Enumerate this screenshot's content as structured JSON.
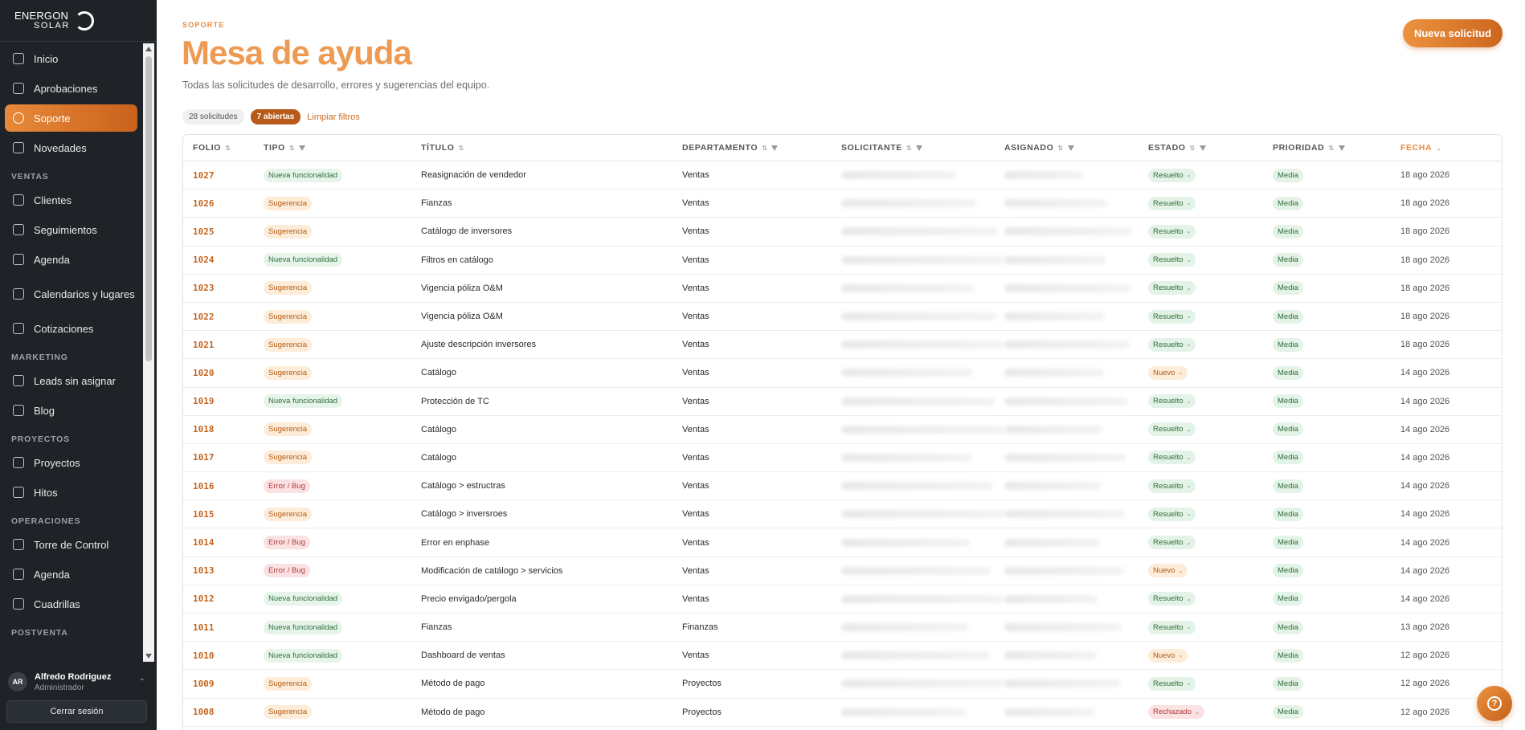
{
  "brand": {
    "name": "ENERGON",
    "sub": "SOLAR"
  },
  "nav": {
    "items_top": [
      {
        "label": "Inicio",
        "name": "sidebar-item-inicio"
      },
      {
        "label": "Aprobaciones",
        "name": "sidebar-item-aprobaciones"
      },
      {
        "label": "Soporte",
        "name": "sidebar-item-soporte",
        "active": true
      }
    ],
    "sections": [
      {
        "title": "VENTAS",
        "items": [
          {
            "label": "Novedades",
            "name": "sidebar-item-novedades",
            "pre": true
          },
          {
            "label": "Clientes",
            "name": "sidebar-item-clientes"
          },
          {
            "label": "Seguimientos",
            "name": "sidebar-item-seguimientos"
          },
          {
            "label": "Agenda",
            "name": "sidebar-item-agenda"
          },
          {
            "label": "Calendarios y lugares",
            "name": "sidebar-item-calendarios",
            "two": true
          },
          {
            "label": "Cotizaciones",
            "name": "sidebar-item-cotizaciones"
          }
        ]
      },
      {
        "title": "MARKETING",
        "items": [
          {
            "label": "Leads sin asignar",
            "name": "sidebar-item-leads"
          },
          {
            "label": "Blog",
            "name": "sidebar-item-blog"
          }
        ]
      },
      {
        "title": "PROYECTOS",
        "items": [
          {
            "label": "Proyectos",
            "name": "sidebar-item-proyectos"
          },
          {
            "label": "Hitos",
            "name": "sidebar-item-hitos"
          }
        ]
      },
      {
        "title": "OPERACIONES",
        "items": [
          {
            "label": "Torre de Control",
            "name": "sidebar-item-torre"
          },
          {
            "label": "Agenda",
            "name": "sidebar-item-agenda-ops"
          },
          {
            "label": "Cuadrillas",
            "name": "sidebar-item-cuadrillas"
          }
        ]
      },
      {
        "title": "POSTVENTA",
        "items": []
      }
    ]
  },
  "user": {
    "initials": "AR",
    "name": "Alfredo Rodriguez",
    "role": "Administrador"
  },
  "logout_label": "Cerrar sesión",
  "header": {
    "eyebrow": "SOPORTE",
    "title": "Mesa de ayuda",
    "description": "Todas las solicitudes de desarrollo, errores y sugerencias del equipo.",
    "new_button": "Nueva solicitud"
  },
  "filters": {
    "count": "28 solicitudes",
    "open": "7 abiertas",
    "clear": "Limpiar filtros"
  },
  "table": {
    "columns": [
      {
        "label": "FOLIO",
        "sort": true,
        "filter": false
      },
      {
        "label": "TIPO",
        "sort": true,
        "filter": true
      },
      {
        "label": "TÍTULO",
        "sort": true,
        "filter": false
      },
      {
        "label": "DEPARTAMENTO",
        "sort": true,
        "filter": true
      },
      {
        "label": "SOLICITANTE",
        "sort": true,
        "filter": true
      },
      {
        "label": "ASIGNADO",
        "sort": true,
        "filter": true
      },
      {
        "label": "ESTADO",
        "sort": true,
        "filter": true
      },
      {
        "label": "PRIORIDAD",
        "sort": true,
        "filter": true
      },
      {
        "label": "FECHA",
        "sort": true,
        "filter": false,
        "active": true
      }
    ],
    "rows": [
      {
        "folio": "1027",
        "tipo": "Nueva funcionalidad",
        "titulo": "Reasignación de vendedor",
        "depto": "Ventas",
        "estado": "Resuelto",
        "prioridad": "Media",
        "fecha": "18 ago 2026"
      },
      {
        "folio": "1026",
        "tipo": "Sugerencia",
        "titulo": "Fianzas",
        "depto": "Ventas",
        "estado": "Resuelto",
        "prioridad": "Media",
        "fecha": "18 ago 2026"
      },
      {
        "folio": "1025",
        "tipo": "Sugerencia",
        "titulo": "Catálogo de inversores",
        "depto": "Ventas",
        "estado": "Resuelto",
        "prioridad": "Media",
        "fecha": "18 ago 2026"
      },
      {
        "folio": "1024",
        "tipo": "Nueva funcionalidad",
        "titulo": "Filtros en catálogo",
        "depto": "Ventas",
        "estado": "Resuelto",
        "prioridad": "Media",
        "fecha": "18 ago 2026"
      },
      {
        "folio": "1023",
        "tipo": "Sugerencia",
        "titulo": "Vigencia póliza O&M",
        "depto": "Ventas",
        "estado": "Resuelto",
        "prioridad": "Media",
        "fecha": "18 ago 2026"
      },
      {
        "folio": "1022",
        "tipo": "Sugerencia",
        "titulo": "Vigencia póliza O&M",
        "depto": "Ventas",
        "estado": "Resuelto",
        "prioridad": "Media",
        "fecha": "18 ago 2026"
      },
      {
        "folio": "1021",
        "tipo": "Sugerencia",
        "titulo": "Ajuste descripción inversores",
        "depto": "Ventas",
        "estado": "Resuelto",
        "prioridad": "Media",
        "fecha": "18 ago 2026"
      },
      {
        "folio": "1020",
        "tipo": "Sugerencia",
        "titulo": "Catálogo",
        "depto": "Ventas",
        "estado": "Nuevo",
        "prioridad": "Media",
        "fecha": "14 ago 2026"
      },
      {
        "folio": "1019",
        "tipo": "Nueva funcionalidad",
        "titulo": "Protección de TC",
        "depto": "Ventas",
        "estado": "Resuelto",
        "prioridad": "Media",
        "fecha": "14 ago 2026"
      },
      {
        "folio": "1018",
        "tipo": "Sugerencia",
        "titulo": "Catálogo",
        "depto": "Ventas",
        "estado": "Resuelto",
        "prioridad": "Media",
        "fecha": "14 ago 2026"
      },
      {
        "folio": "1017",
        "tipo": "Sugerencia",
        "titulo": "Catálogo",
        "depto": "Ventas",
        "estado": "Resuelto",
        "prioridad": "Media",
        "fecha": "14 ago 2026"
      },
      {
        "folio": "1016",
        "tipo": "Error / Bug",
        "titulo": "Catálogo > estructras",
        "depto": "Ventas",
        "estado": "Resuelto",
        "prioridad": "Media",
        "fecha": "14 ago 2026"
      },
      {
        "folio": "1015",
        "tipo": "Sugerencia",
        "titulo": "Catálogo > inversroes",
        "depto": "Ventas",
        "estado": "Resuelto",
        "prioridad": "Media",
        "fecha": "14 ago 2026"
      },
      {
        "folio": "1014",
        "tipo": "Error / Bug",
        "titulo": "Error en enphase",
        "depto": "Ventas",
        "estado": "Resuelto",
        "prioridad": "Media",
        "fecha": "14 ago 2026"
      },
      {
        "folio": "1013",
        "tipo": "Error / Bug",
        "titulo": "Modificación de catálogo > servicios",
        "depto": "Ventas",
        "estado": "Nuevo",
        "prioridad": "Media",
        "fecha": "14 ago 2026"
      },
      {
        "folio": "1012",
        "tipo": "Nueva funcionalidad",
        "titulo": "Precio envigado/pergola",
        "depto": "Ventas",
        "estado": "Resuelto",
        "prioridad": "Media",
        "fecha": "14 ago 2026"
      },
      {
        "folio": "1011",
        "tipo": "Nueva funcionalidad",
        "titulo": "Fianzas",
        "depto": "Finanzas",
        "estado": "Resuelto",
        "prioridad": "Media",
        "fecha": "13 ago 2026"
      },
      {
        "folio": "1010",
        "tipo": "Nueva funcionalidad",
        "titulo": "Dashboard de ventas",
        "depto": "Ventas",
        "estado": "Nuevo",
        "prioridad": "Media",
        "fecha": "12 ago 2026"
      },
      {
        "folio": "1009",
        "tipo": "Sugerencia",
        "titulo": "Método de pago",
        "depto": "Proyectos",
        "estado": "Resuelto",
        "prioridad": "Media",
        "fecha": "12 ago 2026"
      },
      {
        "folio": "1008",
        "tipo": "Sugerencia",
        "titulo": "Método de pago",
        "depto": "Proyectos",
        "estado": "Rechazado",
        "prioridad": "Media",
        "fecha": "12 ago 2026"
      }
    ]
  },
  "colors": {
    "accent": "#e98a3e",
    "sidebar_bg": "#1f2328",
    "active_nav": "#d5722a"
  },
  "icons": {
    "help": "help-bubble-icon"
  }
}
